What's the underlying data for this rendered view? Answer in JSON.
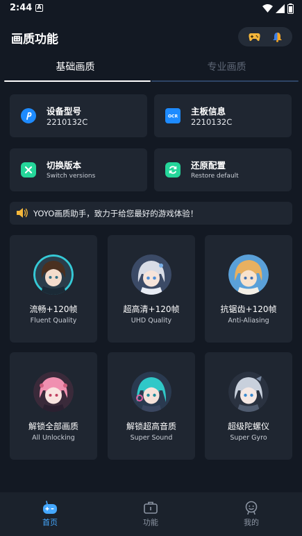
{
  "status_bar": {
    "time": "2:44",
    "notification_letter": "A"
  },
  "header": {
    "title": "画质功能"
  },
  "tabs": [
    {
      "label": "基础画质",
      "active": true
    },
    {
      "label": "专业画质",
      "active": false
    }
  ],
  "info_cards": [
    {
      "title": "设备型号",
      "value": "2210132C",
      "icon": "p-logo-icon",
      "icon_color": "#1e8bff"
    },
    {
      "title": "主板信息",
      "value": "2210132C",
      "icon": "ocr-icon",
      "icon_color": "#1e8bff"
    },
    {
      "title": "切换版本",
      "value": "Switch versions",
      "icon": "switch-icon",
      "icon_color": "#25d69a"
    },
    {
      "title": "还原配置",
      "value": "Restore default",
      "icon": "restore-icon",
      "icon_color": "#25d69a"
    }
  ],
  "notice": {
    "text": "YOYO画质助手，致力于给您最好的游戏体验！"
  },
  "features": [
    {
      "title": "流畅+120帧",
      "subtitle": "Fluent Quality",
      "bg": "#2b3d4a",
      "hair": "#4a3020",
      "ring": "#35c9d6"
    },
    {
      "title": "超高清+120帧",
      "subtitle": "UHD Quality",
      "bg": "#3b4a66",
      "hair": "#d8dce6",
      "ring": "#7bb0e8"
    },
    {
      "title": "抗锯齿+120帧",
      "subtitle": "Anti-Aliasing",
      "bg": "#5aa0d8",
      "hair": "#e8b060",
      "ring": "#f0c890"
    },
    {
      "title": "解锁全部画质",
      "subtitle": "All Unlocking",
      "bg": "#3a2a3a",
      "hair": "#f090b0",
      "ring": "#d06080"
    },
    {
      "title": "解锁超高音质",
      "subtitle": "Super Sound",
      "bg": "#2a3a50",
      "hair": "#30c8c8",
      "ring": "#e060a0"
    },
    {
      "title": "超级陀螺仪",
      "subtitle": "Super Gyro",
      "bg": "#2a3240",
      "hair": "#c8d0dc",
      "ring": "#7888a0"
    }
  ],
  "bottom_nav": [
    {
      "label": "首页",
      "active": true
    },
    {
      "label": "功能",
      "active": false
    },
    {
      "label": "我的",
      "active": false
    }
  ],
  "colors": {
    "accent": "#45a8ff",
    "background": "#131923",
    "card": "#1f2631"
  }
}
